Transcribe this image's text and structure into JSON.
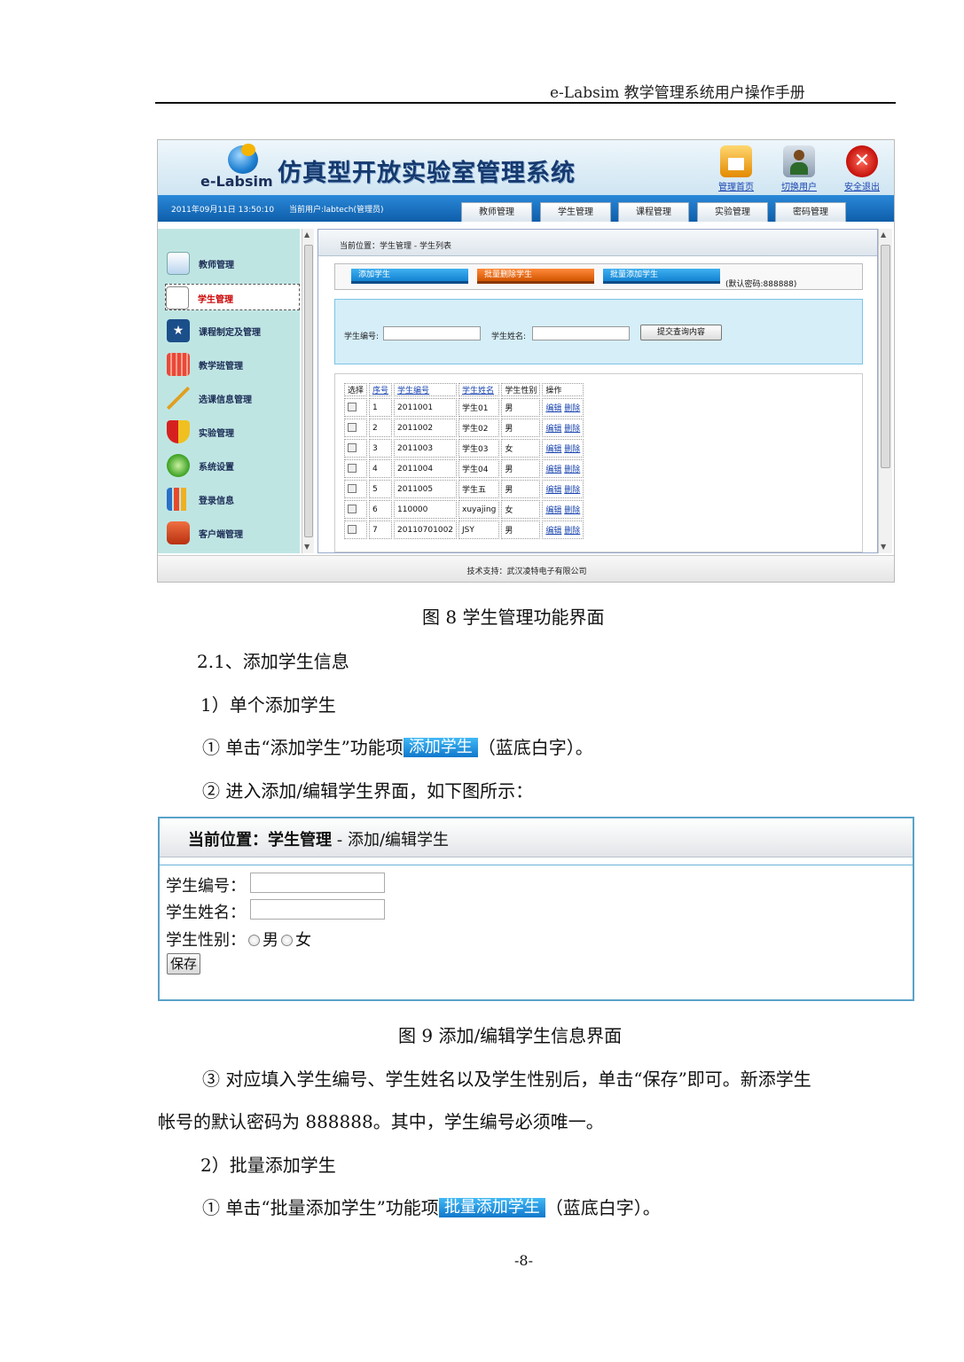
{
  "header": {
    "running_title": "e-Labsim 教学管理系统用户操作手册"
  },
  "figure8": {
    "logo_text": "e-Labsim",
    "app_title": "仿真型开放实验室管理系统",
    "header_links": [
      "管理首页",
      "切换用户",
      "安全退出"
    ],
    "datetime": "2011年09月11日  13:50:10",
    "current_user": "当前用户:labtech(管理员)",
    "nav_tabs": [
      "教师管理",
      "学生管理",
      "课程管理",
      "实验管理",
      "密码管理"
    ],
    "sidebar": [
      "教师管理",
      "学生管理",
      "课程制定及管理",
      "教学班管理",
      "选课信息管理",
      "实验管理",
      "系统设置",
      "登录信息",
      "客户端管理"
    ],
    "breadcrumb": "当前位置：学生管理 - 学生列表",
    "actions": [
      "添加学生",
      "批量删除学生",
      "批量添加学生"
    ],
    "default_pwd_note": "(默认密码:888888)",
    "search": {
      "id_label": "学生编号:",
      "name_label": "学生姓名:",
      "submit": "提交查询内容"
    },
    "table": {
      "headers": [
        "选择",
        "序号",
        "学生编号",
        "学生姓名",
        "学生性别",
        "操作"
      ],
      "rows": [
        [
          "1",
          "2011001",
          "学生01",
          "男"
        ],
        [
          "2",
          "2011002",
          "学生02",
          "男"
        ],
        [
          "3",
          "2011003",
          "学生03",
          "女"
        ],
        [
          "4",
          "2011004",
          "学生04",
          "男"
        ],
        [
          "5",
          "2011005",
          "学生五",
          "男"
        ],
        [
          "6",
          "110000",
          "xuyajing",
          "女"
        ],
        [
          "7",
          "20110701002",
          "JSY",
          "男"
        ]
      ],
      "edit": "编辑",
      "delete": "删除"
    },
    "footer": "技术支持：武汉凌特电子有限公司"
  },
  "caption8": "图 8   学生管理功能界面",
  "sec_2_1": "2.1、添加学生信息",
  "item_single": "1）单个添加学生",
  "step1_pre": "① 单击“添加学生”功能项",
  "step1_btn": "添加学生",
  "step1_post": "（蓝底白字）。",
  "step2": "② 进入添加/编辑学生界面，如下图所示：",
  "figure9": {
    "crumb_bold": "当前位置：学生管理",
    "crumb_rest": " - 添加/编辑学生",
    "id_label": "学生编号：",
    "name_label": "学生姓名：",
    "gender_label": "学生性别：",
    "male": "男",
    "female": "女",
    "save": "保存"
  },
  "caption9": "图 9   添加/编辑学生信息界面",
  "step3_line1": "③ 对应填入学生编号、学生姓名以及学生性别后，单击“保存”即可。新添学生",
  "step3_line2": "帐号的默认密码为 888888。其中，学生编号必须唯一。",
  "item_batch": "2）批量添加学生",
  "batch_pre": "① 单击“批量添加学生”功能项",
  "batch_btn": "批量添加学生",
  "batch_post": "（蓝底白字）。",
  "page_number": "-8-"
}
